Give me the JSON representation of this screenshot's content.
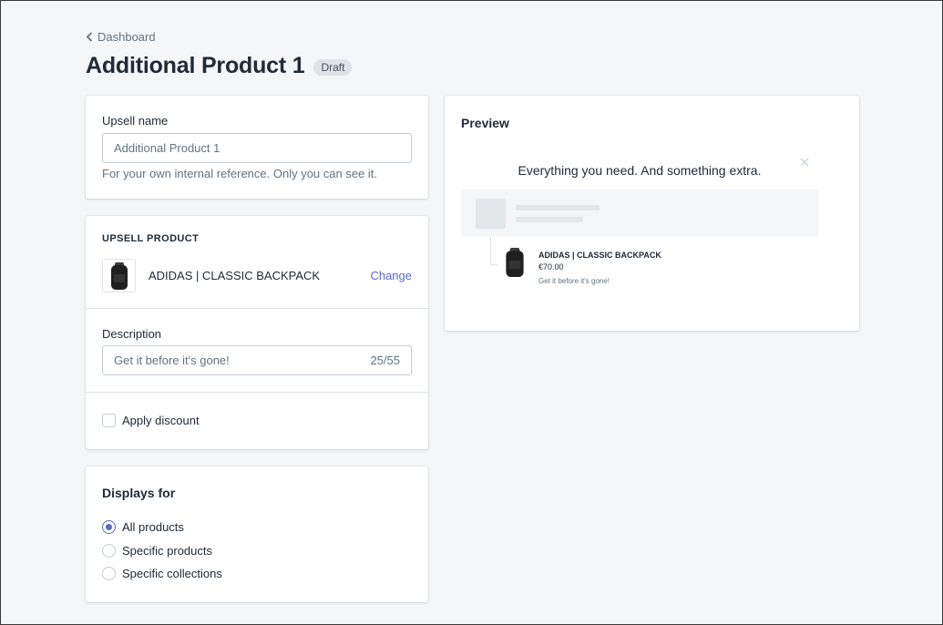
{
  "breadcrumb": {
    "label": "Dashboard"
  },
  "page": {
    "title": "Additional Product 1",
    "status_badge": "Draft"
  },
  "upsell_name_card": {
    "label": "Upsell name",
    "input_value": "Additional Product 1",
    "help_text": "For your own internal reference. Only you can see it."
  },
  "upsell_product_card": {
    "heading": "UPSELL PRODUCT",
    "product_name": "ADIDAS | CLASSIC BACKPACK",
    "change_label": "Change",
    "description_label": "Description",
    "description_value": "Get it before it's gone!",
    "char_count": "25/55",
    "apply_discount_label": "Apply discount"
  },
  "displays_for_card": {
    "title": "Displays for",
    "options": [
      {
        "label": "All products",
        "selected": true
      },
      {
        "label": "Specific products",
        "selected": false
      },
      {
        "label": "Specific collections",
        "selected": false
      }
    ]
  },
  "preview_card": {
    "title": "Preview",
    "headline": "Everything you need. And something extra.",
    "product_name": "ADIDAS | CLASSIC BACKPACK",
    "price": "€70.00",
    "description": "Get it before it's gone!"
  },
  "colors": {
    "accent": "#5c6ac4",
    "background": "#f4f6f8",
    "text": "#212b36",
    "muted": "#637381"
  }
}
